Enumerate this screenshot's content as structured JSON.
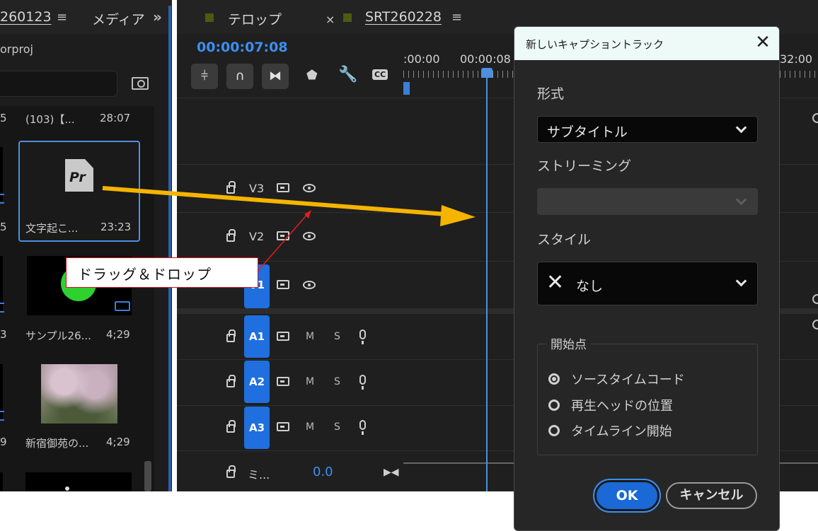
{
  "project_panel": {
    "tab_bin": "260123",
    "tab_media": "メディア",
    "overflow_glyph": "»",
    "filename": "orproj",
    "thumbnails": [
      {
        "name": "(103)【...",
        "duration": "28:07"
      },
      {
        "name": "文字起こ...",
        "duration": "23:23"
      },
      {
        "name": "サンプル26...",
        "duration": "4;29"
      },
      {
        "name": "新宿御苑の...",
        "duration": "4;29"
      }
    ],
    "left_column_clip_digits": [
      "5",
      "5",
      "3",
      "9"
    ],
    "pr_icon": "Pr"
  },
  "timeline": {
    "tabs": [
      {
        "label": "テロップ",
        "menu": ""
      },
      {
        "label": "SRT260228",
        "menu": "≡",
        "close": "×"
      }
    ],
    "timecode": "00:00:07:08",
    "ruler": {
      "t0": ":00:00",
      "t1": "00:00:08",
      "t_end": "32:00"
    },
    "tool_icons": [
      "insert-edit-icon",
      "snap-icon",
      "linked-selection-icon",
      "marker-icon",
      "wrench-icon",
      "captions-icon"
    ],
    "captions_label": "CC",
    "tracks": [
      {
        "name": "V3",
        "type": "video"
      },
      {
        "name": "V2",
        "type": "video"
      },
      {
        "name": "V1",
        "type": "video"
      },
      {
        "name": "A1",
        "type": "audio",
        "m": "M",
        "s": "S"
      },
      {
        "name": "A2",
        "type": "audio",
        "m": "M",
        "s": "S"
      },
      {
        "name": "A3",
        "type": "audio",
        "m": "M",
        "s": "S"
      }
    ],
    "master": {
      "label": "ミ...",
      "value": "0.0"
    }
  },
  "dialog": {
    "title": "新しいキャプショントラック",
    "format_label": "形式",
    "format_value": "サブタイトル",
    "streaming_label": "ストリーミング",
    "streaming_value": "",
    "style_label": "スタイル",
    "style_value": "なし",
    "start_label": "開始点",
    "start_options": [
      {
        "label": "ソースタイムコード",
        "checked": true
      },
      {
        "label": "再生ヘッドの位置",
        "checked": false
      },
      {
        "label": "タイムライン開始",
        "checked": false
      }
    ],
    "ok": "OK",
    "cancel": "キャンセル"
  },
  "annotation": {
    "callout_text": "ドラッグ＆ドロップ",
    "arrow_color": "#f5b400",
    "line_color": "#e0201c"
  },
  "colors": {
    "accent": "#1a69d6",
    "timecode": "#3d8ef0",
    "panel_bg": "#1f1f1f"
  }
}
